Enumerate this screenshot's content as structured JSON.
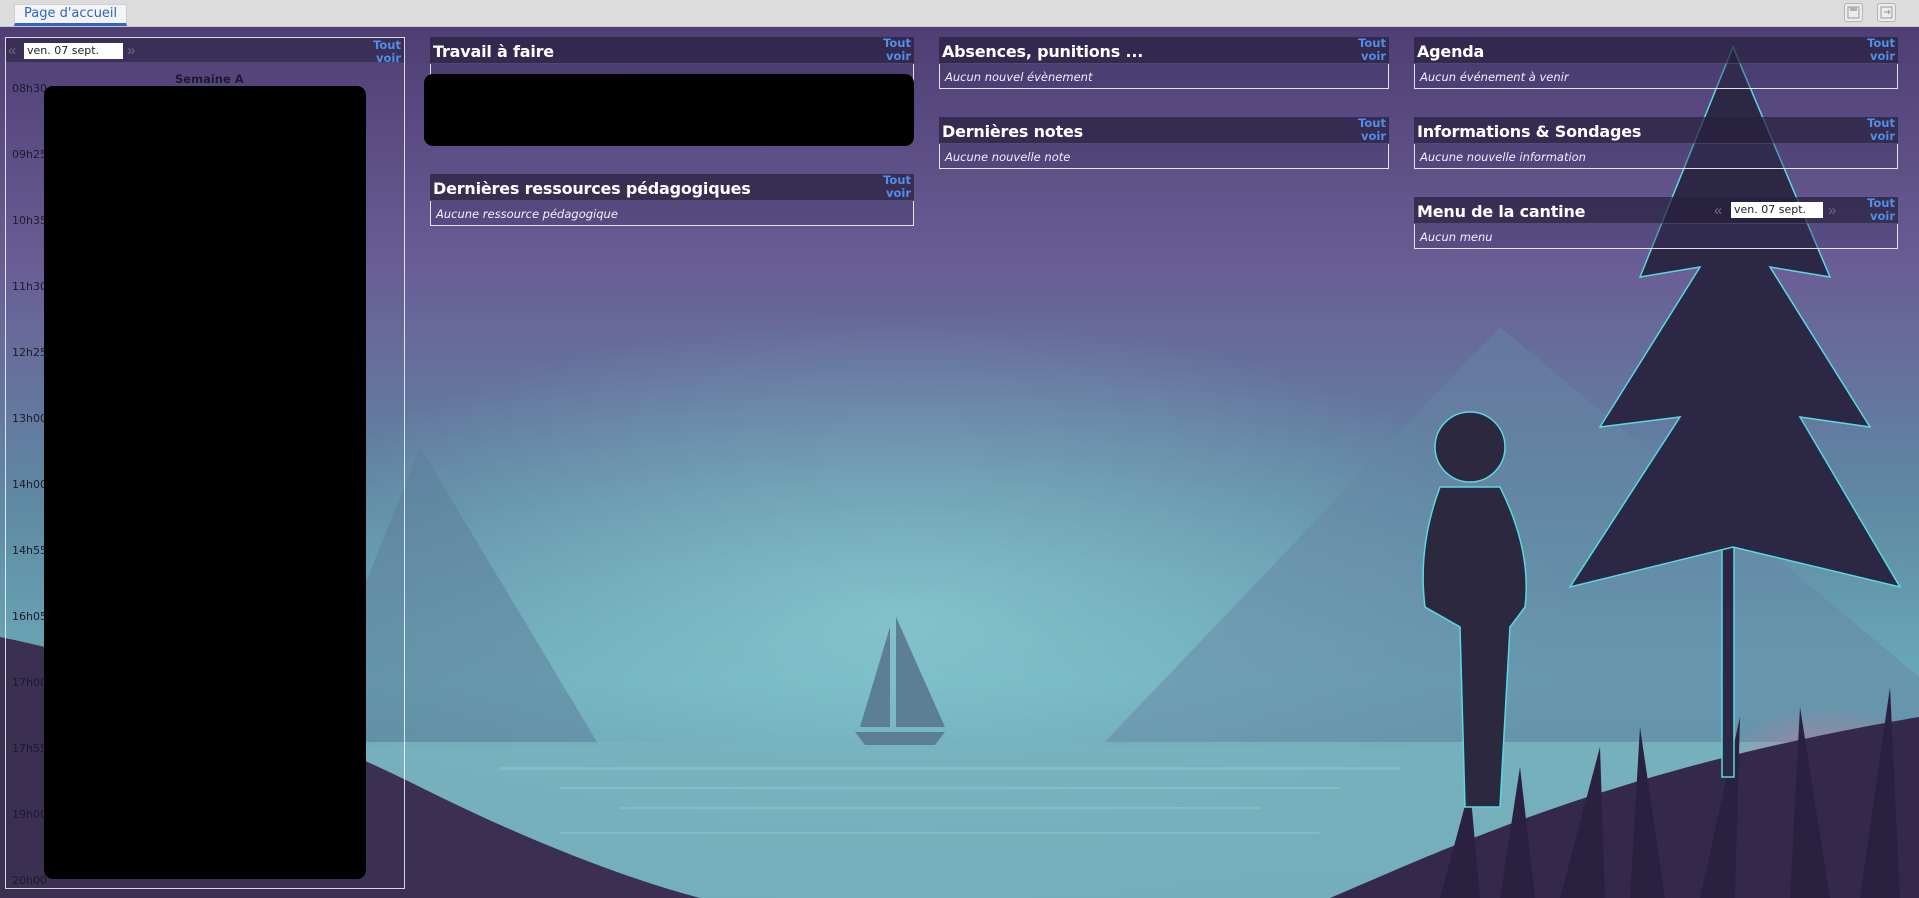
{
  "tabs": [
    {
      "label": "Page d'accueil"
    }
  ],
  "toolbar": {
    "icons": [
      "save-icon",
      "exit-icon"
    ]
  },
  "timetable": {
    "date": "ven. 07 sept.",
    "week_label": "Semaine A",
    "times": [
      "08h30",
      "09h25",
      "10h35",
      "11h30",
      "12h25",
      "13h00",
      "14h00",
      "14h55",
      "16h05",
      "17h00",
      "17h55",
      "19h00",
      "20h00"
    ],
    "see_all": "Tout voir"
  },
  "widgets": {
    "travail": {
      "title": "Travail à faire",
      "link": "Tout voir"
    },
    "ressources": {
      "title": "Dernières ressources pédagogiques",
      "link": "Tout voir",
      "empty": "Aucune ressource pédagogique"
    },
    "absences": {
      "title": "Absences, punitions ...",
      "link": "Tout voir",
      "empty": "Aucun nouvel évènement"
    },
    "notes": {
      "title": "Dernières notes",
      "link": "Tout voir",
      "empty": "Aucune nouvelle note"
    },
    "agenda": {
      "title": "Agenda",
      "link": "Tout voir",
      "empty": "Aucun événement à venir"
    },
    "informations": {
      "title": "Informations & Sondages",
      "link": "Tout voir",
      "empty": "Aucune nouvelle information"
    },
    "cantine": {
      "title": "Menu de la cantine",
      "link": "Tout voir",
      "date": "ven. 07 sept.",
      "empty": "Aucun menu"
    }
  },
  "colors": {
    "accent": "#2f63c4",
    "link": "#4f8fe8",
    "sky_top": "#5a4a85",
    "water": "#7bb6c2"
  }
}
